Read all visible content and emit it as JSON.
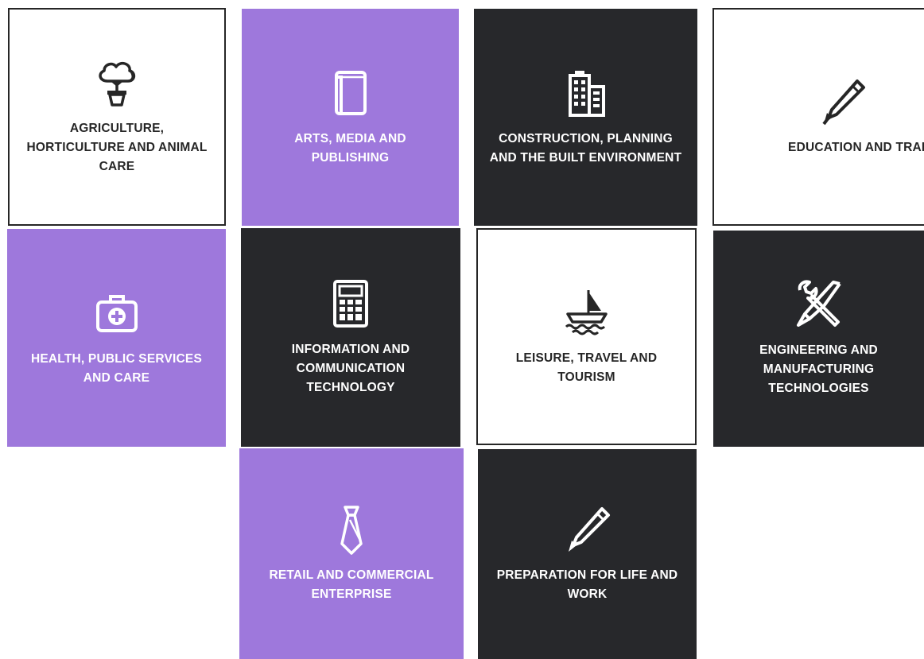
{
  "tiles": [
    {
      "label": "AGRICULTURE, HORTICULTURE AND ANIMAL CARE",
      "icon": "tree-pot-icon",
      "theme": "white"
    },
    {
      "label": "ARTS, MEDIA AND PUBLISHING",
      "icon": "book-icon",
      "theme": "purple"
    },
    {
      "label": "CONSTRUCTION, PLANNING AND THE BUILT ENVIRONMENT",
      "icon": "buildings-icon",
      "theme": "dark"
    },
    {
      "label": "EDUCATION AND TRAINING",
      "icon": "pen-icon",
      "theme": "white"
    },
    {
      "label": "HEALTH, PUBLIC SERVICES AND CARE",
      "icon": "medical-kit-icon",
      "theme": "purple"
    },
    {
      "label": "INFORMATION AND COMMUNICATION TECHNOLOGY",
      "icon": "calculator-icon",
      "theme": "dark"
    },
    {
      "label": "LEISURE, TRAVEL AND TOURISM",
      "icon": "sailboat-icon",
      "theme": "white"
    },
    {
      "label": "ENGINEERING AND MANUFACTURING TECHNOLOGIES",
      "icon": "wrench-screwdriver-icon",
      "theme": "dark"
    },
    {
      "label": "RETAIL AND COMMERCIAL ENTERPRISE",
      "icon": "necktie-icon",
      "theme": "purple"
    },
    {
      "label": "PREPARATION FOR LIFE AND WORK",
      "icon": "pen-icon",
      "theme": "dark"
    }
  ],
  "colors": {
    "purple": "#9e78dc",
    "dark": "#27282b",
    "white": "#ffffff",
    "border": "#262626"
  }
}
